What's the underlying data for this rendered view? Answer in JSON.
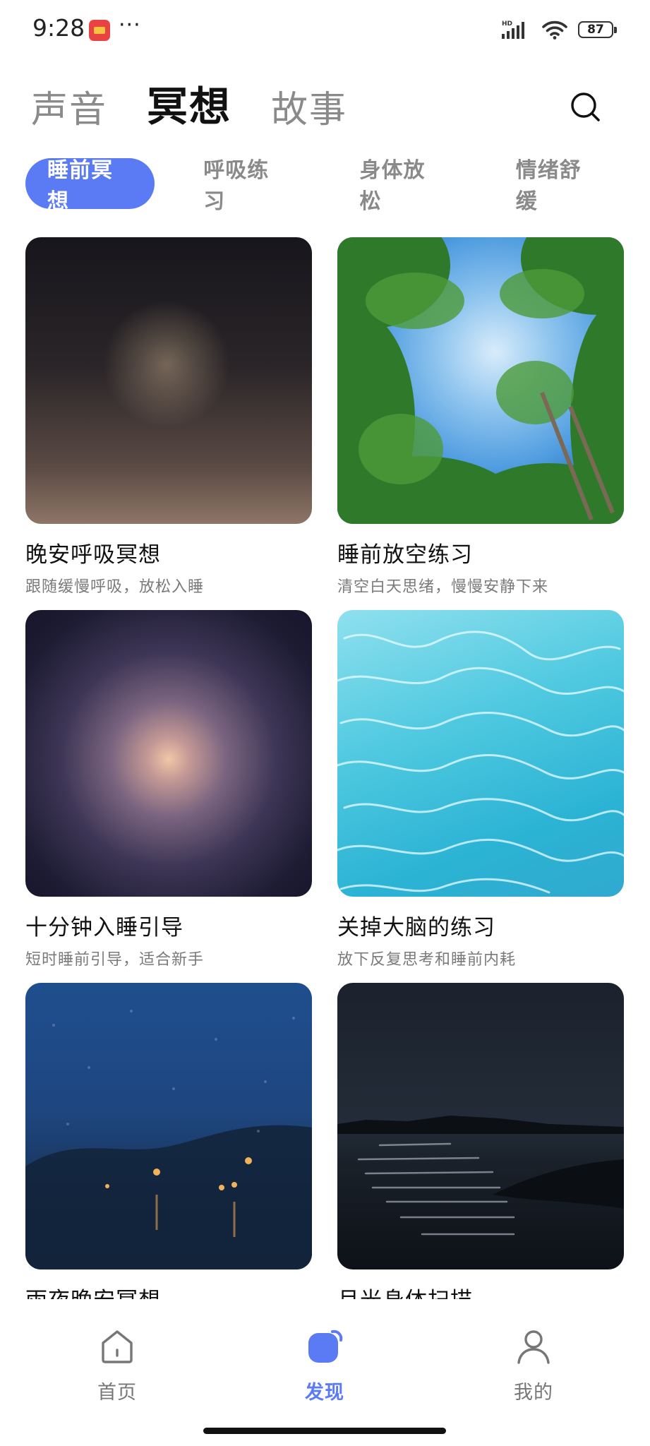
{
  "status_bar": {
    "time": "9:28",
    "more": "···",
    "network": "HD",
    "battery": "87",
    "icons": [
      "app-icon",
      "signal-icon",
      "wifi-icon",
      "battery-icon"
    ]
  },
  "header": {
    "tabs": [
      {
        "label": "声音",
        "active": false
      },
      {
        "label": "冥想",
        "active": true
      },
      {
        "label": "故事",
        "active": false
      }
    ],
    "search_icon": "search-icon"
  },
  "categories": [
    {
      "label": "睡前冥想",
      "active": true
    },
    {
      "label": "呼吸练习",
      "active": false
    },
    {
      "label": "身体放松",
      "active": false
    },
    {
      "label": "情绪舒缓",
      "active": false
    }
  ],
  "cards": [
    {
      "title": "晚安呼吸冥想",
      "subtitle": "跟随缓慢呼吸，放松入睡",
      "image": "crescent-moon"
    },
    {
      "title": "睡前放空练习",
      "subtitle": "清空白天思绪，慢慢安静下来",
      "image": "forest-sky"
    },
    {
      "title": "十分钟入睡引导",
      "subtitle": "短时睡前引导，适合新手",
      "image": "soft-glow"
    },
    {
      "title": "关掉大脑的练习",
      "subtitle": "放下反复思考和睡前内耗",
      "image": "pool-water"
    },
    {
      "title": "雨夜晚安冥想",
      "subtitle": "",
      "image": "rainy-window"
    },
    {
      "title": "月光身体扫描",
      "subtitle": "",
      "image": "moonlit-lake"
    }
  ],
  "bottom_nav": [
    {
      "label": "首页",
      "icon": "home-icon",
      "active": false
    },
    {
      "label": "发现",
      "icon": "discover-icon",
      "active": true
    },
    {
      "label": "我的",
      "icon": "profile-icon",
      "active": false
    }
  ],
  "colors": {
    "accent": "#5b7bf5",
    "inactive_text": "#8a8a8a"
  }
}
